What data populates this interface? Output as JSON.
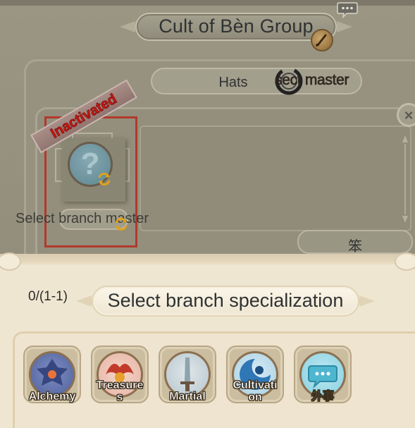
{
  "header": {
    "title": "Cult of Bèn Group"
  },
  "tabs": {
    "hats_label": "Hats",
    "sect_master_label": "sect master"
  },
  "slot": {
    "status_ribbon": "Inactivated",
    "placeholder_symbol": "?",
    "branch_label": "Select branch master"
  },
  "confirm_button": {
    "label": "笨"
  },
  "close_button": {
    "label": "×"
  },
  "specialization": {
    "counter": "0/(1-1)",
    "title": "Select branch specialization",
    "items": [
      {
        "label": "Alchemy",
        "icon": "alchemy-icon",
        "color": "#4f5f9a"
      },
      {
        "label": "Treasure\ns",
        "icon": "treasures-icon",
        "color": "#c23a2a"
      },
      {
        "label": "Martial",
        "icon": "martial-icon",
        "color": "#9fb3be"
      },
      {
        "label": "Cultivati\non",
        "icon": "cultivation-icon",
        "color": "#2f77b5"
      },
      {
        "label": "外事",
        "icon": "external-affairs-icon",
        "color": "#4fb6d0"
      }
    ]
  },
  "colors": {
    "ribbon_text": "#cc1a14",
    "slot_frame": "#b1392c",
    "lower_panel": "#efe6d2",
    "dim_overlay": "#938e7c"
  }
}
